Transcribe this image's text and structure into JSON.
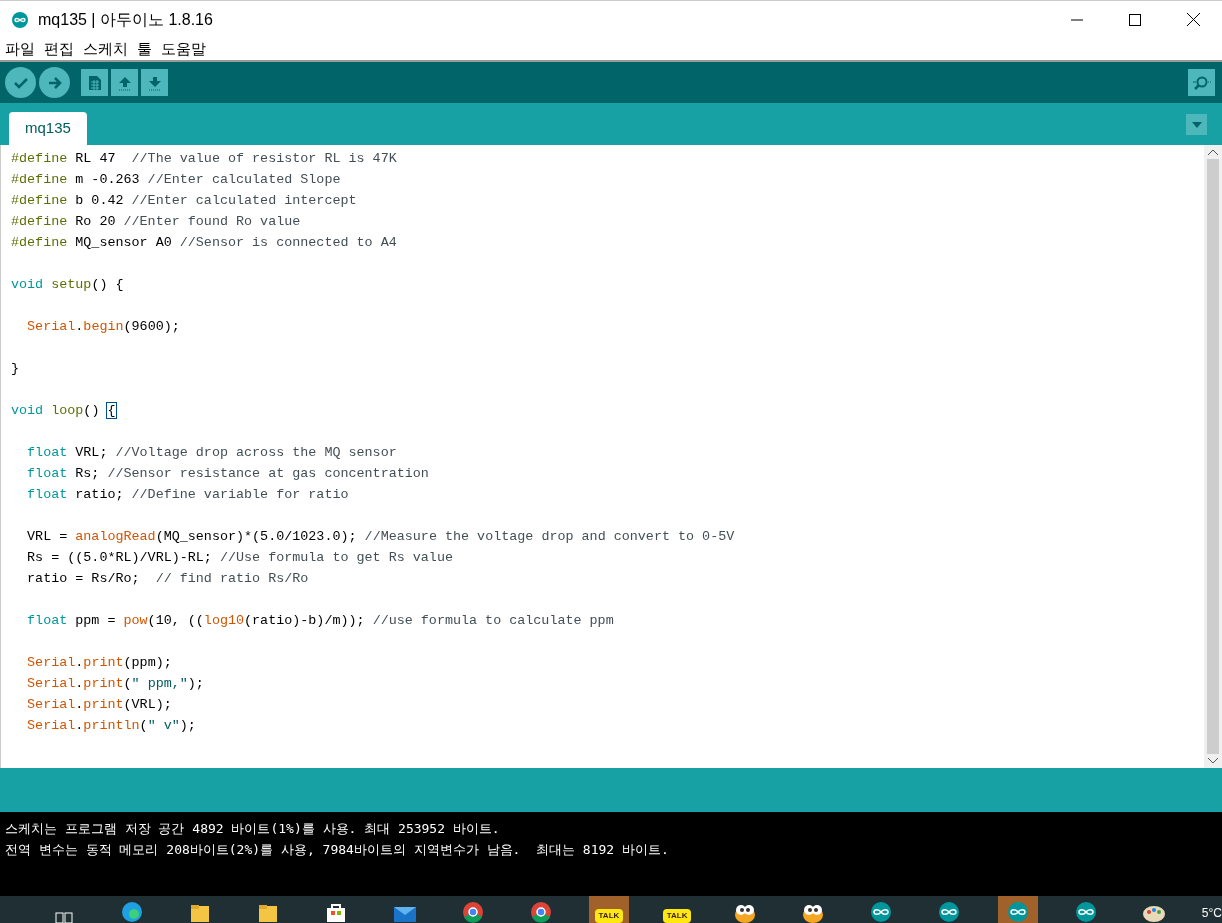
{
  "window": {
    "title": "mq135 | 아두이노 1.8.16"
  },
  "menu": [
    "파일",
    "편집",
    "스케치",
    "툴",
    "도움말"
  ],
  "toolbar": [
    {
      "kind": "verify"
    },
    {
      "kind": "upload"
    },
    {
      "kind": "new"
    },
    {
      "kind": "open"
    },
    {
      "kind": "save"
    }
  ],
  "tabs": [
    {
      "label": "mq135",
      "selected": true
    }
  ],
  "editor": {
    "lines": [
      {
        "kind": "code",
        "segments": [
          {
            "kind": "define",
            "text": "#define"
          },
          {
            "kind": "plain",
            "text": " RL 47  "
          },
          {
            "kind": "comment",
            "text": "//The value of resistor RL is 47K"
          }
        ]
      },
      {
        "kind": "code",
        "segments": [
          {
            "kind": "define",
            "text": "#define"
          },
          {
            "kind": "plain",
            "text": " m -0.263 "
          },
          {
            "kind": "comment",
            "text": "//Enter calculated Slope"
          }
        ]
      },
      {
        "kind": "code",
        "segments": [
          {
            "kind": "define",
            "text": "#define"
          },
          {
            "kind": "plain",
            "text": " b 0.42 "
          },
          {
            "kind": "comment",
            "text": "//Enter calculated intercept"
          }
        ]
      },
      {
        "kind": "code",
        "segments": [
          {
            "kind": "define",
            "text": "#define"
          },
          {
            "kind": "plain",
            "text": " Ro 20 "
          },
          {
            "kind": "comment",
            "text": "//Enter found Ro value"
          }
        ]
      },
      {
        "kind": "code",
        "segments": [
          {
            "kind": "define",
            "text": "#define"
          },
          {
            "kind": "plain",
            "text": " MQ_sensor A0 "
          },
          {
            "kind": "comment",
            "text": "//Sensor is connected to A4"
          }
        ]
      },
      {
        "kind": "blank"
      },
      {
        "kind": "code",
        "segments": [
          {
            "kind": "type",
            "text": "void"
          },
          {
            "kind": "define",
            "text": " setup"
          },
          {
            "kind": "plain",
            "text": "() {"
          }
        ]
      },
      {
        "kind": "blank"
      },
      {
        "kind": "code",
        "segments": [
          {
            "kind": "func",
            "text": "  Serial"
          },
          {
            "kind": "plain",
            "text": "."
          },
          {
            "kind": "func",
            "text": "begin"
          },
          {
            "kind": "plain",
            "text": "(9600);"
          }
        ]
      },
      {
        "kind": "blank"
      },
      {
        "kind": "code",
        "segments": [
          {
            "kind": "plain",
            "text": "}"
          }
        ]
      },
      {
        "kind": "blank"
      },
      {
        "kind": "code",
        "segments": [
          {
            "kind": "type",
            "text": "void"
          },
          {
            "kind": "define",
            "text": " loop"
          },
          {
            "kind": "plain",
            "text": "() "
          },
          {
            "kind": "match",
            "text": "{"
          }
        ]
      },
      {
        "kind": "blank"
      },
      {
        "kind": "code",
        "segments": [
          {
            "kind": "type",
            "text": "  float"
          },
          {
            "kind": "plain",
            "text": " VRL; "
          },
          {
            "kind": "comment",
            "text": "//Voltage drop across the MQ sensor"
          }
        ]
      },
      {
        "kind": "code",
        "segments": [
          {
            "kind": "type",
            "text": "  float"
          },
          {
            "kind": "plain",
            "text": " Rs; "
          },
          {
            "kind": "comment",
            "text": "//Sensor resistance at gas concentration"
          }
        ]
      },
      {
        "kind": "code",
        "segments": [
          {
            "kind": "type",
            "text": "  float"
          },
          {
            "kind": "plain",
            "text": " ratio; "
          },
          {
            "kind": "comment",
            "text": "//Define variable for ratio"
          }
        ]
      },
      {
        "kind": "blank"
      },
      {
        "kind": "code",
        "segments": [
          {
            "kind": "plain",
            "text": "  VRL = "
          },
          {
            "kind": "func",
            "text": "analogRead"
          },
          {
            "kind": "plain",
            "text": "(MQ_sensor)*(5.0/1023.0); "
          },
          {
            "kind": "comment",
            "text": "//Measure the voltage drop and convert to 0-5V"
          }
        ]
      },
      {
        "kind": "code",
        "segments": [
          {
            "kind": "plain",
            "text": "  Rs = ((5.0*RL)/VRL)-RL; "
          },
          {
            "kind": "comment",
            "text": "//Use formula to get Rs value"
          }
        ]
      },
      {
        "kind": "code",
        "segments": [
          {
            "kind": "plain",
            "text": "  ratio = Rs/Ro;  "
          },
          {
            "kind": "comment",
            "text": "// find ratio Rs/Ro"
          }
        ]
      },
      {
        "kind": "blank"
      },
      {
        "kind": "code",
        "segments": [
          {
            "kind": "type",
            "text": "  float"
          },
          {
            "kind": "plain",
            "text": " ppm = "
          },
          {
            "kind": "func",
            "text": "pow"
          },
          {
            "kind": "plain",
            "text": "(10, (("
          },
          {
            "kind": "func",
            "text": "log10"
          },
          {
            "kind": "plain",
            "text": "(ratio)-b)/m)); "
          },
          {
            "kind": "comment",
            "text": "//use formula to calculate ppm"
          }
        ]
      },
      {
        "kind": "blank"
      },
      {
        "kind": "code",
        "segments": [
          {
            "kind": "func",
            "text": "  Serial"
          },
          {
            "kind": "plain",
            "text": "."
          },
          {
            "kind": "func",
            "text": "print"
          },
          {
            "kind": "plain",
            "text": "(ppm);"
          }
        ]
      },
      {
        "kind": "code",
        "segments": [
          {
            "kind": "func",
            "text": "  Serial"
          },
          {
            "kind": "plain",
            "text": "."
          },
          {
            "kind": "func",
            "text": "print"
          },
          {
            "kind": "plain",
            "text": "("
          },
          {
            "kind": "string",
            "text": "\" ppm,\""
          },
          {
            "kind": "plain",
            "text": ");"
          }
        ]
      },
      {
        "kind": "code",
        "segments": [
          {
            "kind": "func",
            "text": "  Serial"
          },
          {
            "kind": "plain",
            "text": "."
          },
          {
            "kind": "func",
            "text": "print"
          },
          {
            "kind": "plain",
            "text": "(VRL);"
          }
        ]
      },
      {
        "kind": "code",
        "segments": [
          {
            "kind": "func",
            "text": "  Serial"
          },
          {
            "kind": "plain",
            "text": "."
          },
          {
            "kind": "func",
            "text": "println"
          },
          {
            "kind": "plain",
            "text": "("
          },
          {
            "kind": "string",
            "text": "\" v\""
          },
          {
            "kind": "plain",
            "text": ");"
          }
        ]
      }
    ]
  },
  "console": [
    "스케치는 프로그램 저장 공간 4892 바이트(1%)를 사용. 최대 253952 바이트.",
    "전역 변수는 동적 메모리 208바이트(2%)를 사용, 7984바이트의 지역변수가 남음.  최대는 8192 바이트."
  ],
  "taskbar": {
    "items": [
      {
        "kind": "taskview",
        "selected": false
      },
      {
        "kind": "edge",
        "selected": false
      },
      {
        "kind": "folder",
        "selected": false
      },
      {
        "kind": "folder",
        "selected": false
      },
      {
        "kind": "store",
        "selected": false
      },
      {
        "kind": "mail",
        "selected": false
      },
      {
        "kind": "chrome",
        "selected": false
      },
      {
        "kind": "chrome",
        "selected": false
      },
      {
        "kind": "talk",
        "label": "TALK",
        "selected": true
      },
      {
        "kind": "talk",
        "label": "TALK",
        "selected": false
      },
      {
        "kind": "owl",
        "selected": false
      },
      {
        "kind": "owl",
        "selected": false
      },
      {
        "kind": "arduino",
        "selected": false
      },
      {
        "kind": "arduino",
        "selected": false
      },
      {
        "kind": "arduino",
        "selected": true
      },
      {
        "kind": "arduino",
        "selected": false
      },
      {
        "kind": "paint",
        "selected": false
      }
    ],
    "weather": "5°C"
  }
}
